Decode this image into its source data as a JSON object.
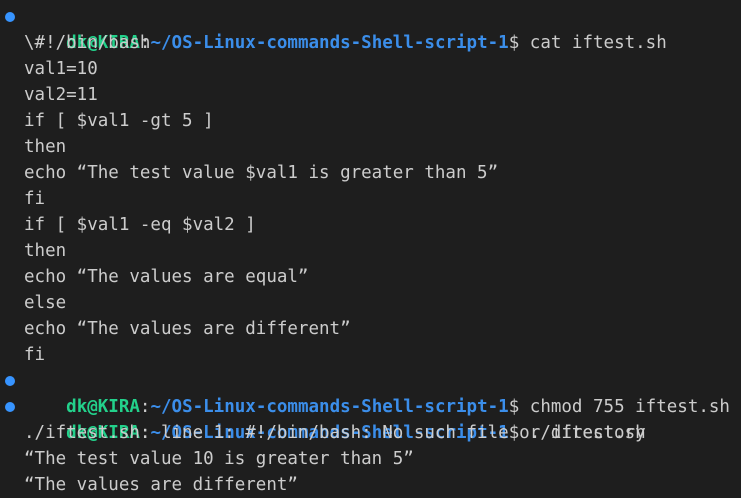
{
  "prompt": {
    "user_host": "dk@KIRA",
    "separator": ":",
    "path": "~/OS-Linux-commands-Shell-script-1",
    "symbol": "$ "
  },
  "colors": {
    "background": "#1e1e1e",
    "text": "#cccccc",
    "user_host": "#23d18b",
    "path": "#3b8eea",
    "status_dot": "#3794ff"
  },
  "commands": [
    "cat iftest.sh",
    "chmod 755 iftest.sh",
    "./iftest.sh"
  ],
  "file_lines": [
    "\\#!/bin/bash",
    "val1=10",
    "val2=11",
    "if [ $val1 -gt 5 ]",
    "then",
    "echo “The test value $val1 is greater than 5”",
    "fi",
    "if [ $val1 -eq $val2 ]",
    "then",
    "echo “The values are equal”",
    "else",
    "echo “The values are different”",
    "fi"
  ],
  "run_output": [
    "./iftest.sh: line 1: #!/bin/bash: No such file or directory",
    "“The test value 10 is greater than 5”",
    "“The values are different”"
  ]
}
